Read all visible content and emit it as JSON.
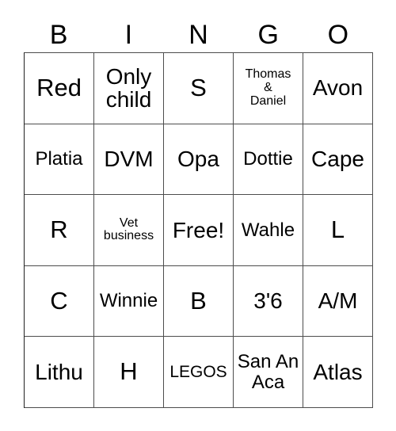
{
  "card": {
    "title": "BINGO card",
    "headers": [
      "B",
      "I",
      "N",
      "G",
      "O"
    ],
    "free_space_label": "Free!",
    "rows": [
      [
        {
          "text": "Red",
          "size": "fs-xl"
        },
        {
          "text": "Only\nchild",
          "size": "fs-lg"
        },
        {
          "text": "S",
          "size": "fs-xl"
        },
        {
          "text": "Thomas\n&\nDaniel",
          "size": "fs-xs"
        },
        {
          "text": "Avon",
          "size": "fs-lg"
        }
      ],
      [
        {
          "text": "Platia",
          "size": "fs-md"
        },
        {
          "text": "DVM",
          "size": "fs-lg"
        },
        {
          "text": "Opa",
          "size": "fs-lg"
        },
        {
          "text": "Dottie",
          "size": "fs-md"
        },
        {
          "text": "Cape",
          "size": "fs-lg"
        }
      ],
      [
        {
          "text": "R",
          "size": "fs-xl"
        },
        {
          "text": "Vet\nbusiness",
          "size": "fs-xs"
        },
        {
          "text": "Free!",
          "size": "fs-lg"
        },
        {
          "text": "Wahle",
          "size": "fs-md"
        },
        {
          "text": "L",
          "size": "fs-xl"
        }
      ],
      [
        {
          "text": "C",
          "size": "fs-xl"
        },
        {
          "text": "Winnie",
          "size": "fs-md"
        },
        {
          "text": "B",
          "size": "fs-xl"
        },
        {
          "text": "3'6",
          "size": "fs-lg"
        },
        {
          "text": "A/M",
          "size": "fs-lg"
        }
      ],
      [
        {
          "text": "Lithu",
          "size": "fs-lg"
        },
        {
          "text": "H",
          "size": "fs-xl"
        },
        {
          "text": "LEGOS",
          "size": "fs-sm"
        },
        {
          "text": "San An\nAca",
          "size": "fs-md"
        },
        {
          "text": "Atlas",
          "size": "fs-lg"
        }
      ]
    ]
  },
  "colors": {
    "text": "#000000",
    "border": "#4d4d4d",
    "background": "#ffffff"
  }
}
